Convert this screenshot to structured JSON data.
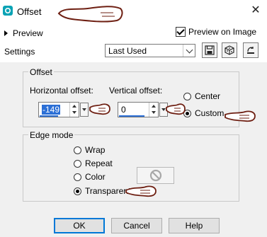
{
  "window": {
    "title": "Offset",
    "close_glyph": "✕"
  },
  "header": {
    "preview_label": "Preview",
    "preview_on_image_label": "Preview on Image",
    "preview_on_image_checked": true,
    "settings_label": "Settings",
    "settings_value": "Last Used",
    "tool_icons": [
      "save-preset-icon",
      "randomize-icon",
      "reset-icon"
    ]
  },
  "offset_group": {
    "label": "Offset",
    "horizontal_label": "Horizontal offset:",
    "horizontal_value": "-149",
    "vertical_label": "Vertical offset:",
    "vertical_value": "0",
    "center_label": "Center",
    "custom_label": "Custom",
    "selected": "Custom"
  },
  "edge_group": {
    "label": "Edge mode",
    "options": [
      "Wrap",
      "Repeat",
      "Color",
      "Transparent"
    ],
    "selected": "Transparent"
  },
  "buttons": {
    "ok": "OK",
    "cancel": "Cancel",
    "help": "Help"
  },
  "colors": {
    "accent": "#0078d7",
    "selection": "#2b6fd6",
    "panel": "#f0f0f0",
    "hand_stroke": "#6e1f12"
  }
}
